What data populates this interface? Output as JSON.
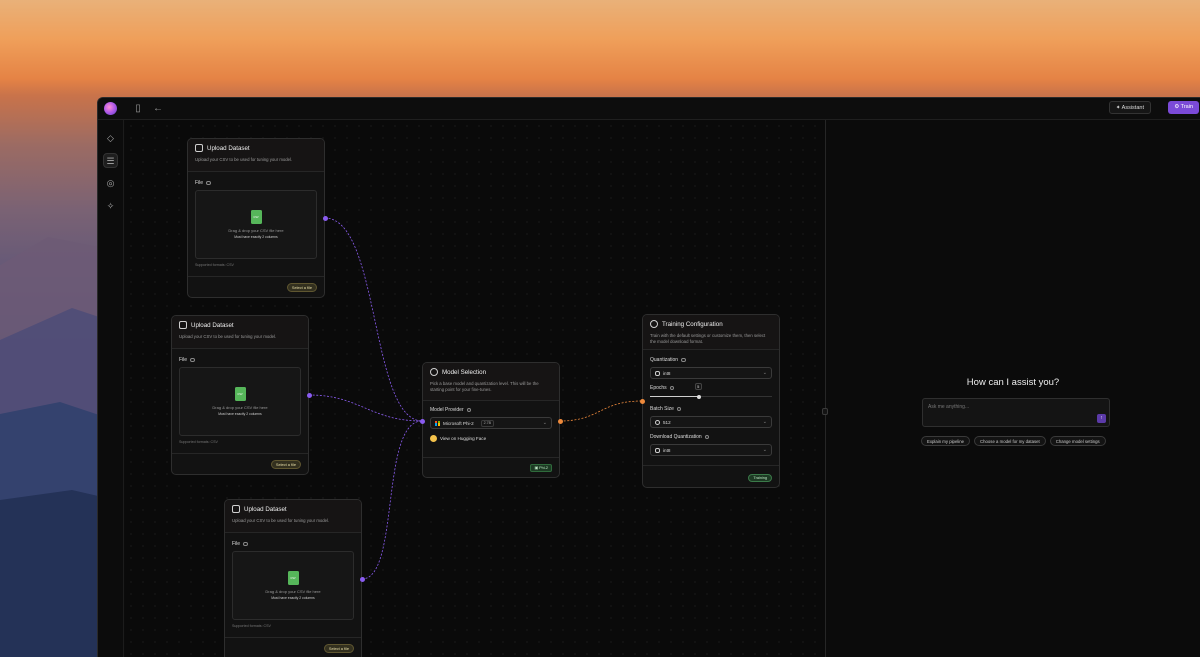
{
  "topbar": {
    "assistant_label": "Assistant",
    "train_label": "Train"
  },
  "upload_nodes": [
    {
      "title": "Upload Dataset",
      "subtitle": "Upload your CSV to be used for tuning your model.",
      "field_label": "File",
      "drop_text": "Drag & drop your CSV file here",
      "drop_hint": "Must have exactly 2 columns",
      "formats": "Supported formats: CSV",
      "button": "Select a file"
    },
    {
      "title": "Upload Dataset",
      "subtitle": "Upload your CSV to be used for tuning your model.",
      "field_label": "File",
      "drop_text": "Drag & drop your CSV file here",
      "drop_hint": "Must have exactly 2 columns",
      "formats": "Supported formats: CSV",
      "button": "Select a file"
    },
    {
      "title": "Upload Dataset",
      "subtitle": "Upload your CSV to be used for tuning your model.",
      "field_label": "File",
      "drop_text": "Drag & drop your CSV file here",
      "drop_hint": "Must have exactly 2 columns",
      "formats": "Supported formats: CSV",
      "button": "Select a file"
    }
  ],
  "model_node": {
    "title": "Model Selection",
    "subtitle": "Pick a base model and quantization level. This will be the starting point for your fine-tunes.",
    "field_label": "Model Provider",
    "selected_model": "Microsoft Phi-2",
    "selected_tag": "2.7B",
    "hf_link": "View on Hugging Face",
    "badge": "Phi-2"
  },
  "training_node": {
    "title": "Training Configuration",
    "subtitle": "Train with the default settings or customize them, then select the model download format.",
    "quantization_label": "Quantization",
    "quantization_value": "int8",
    "epochs_label": "Epochs",
    "epochs_value": "5",
    "epochs_fraction": 0.4,
    "batch_label": "Batch Size",
    "batch_value": "512",
    "download_label": "Download Quantization",
    "download_value": "int8",
    "badge": "Training"
  },
  "assistant": {
    "heading": "How can I assist you?",
    "placeholder": "Ask me anything...",
    "send_icon": "arrow-up-icon",
    "chips": [
      "Explain my pipeline",
      "Choose a model for my dataset",
      "Change model settings"
    ]
  },
  "colors": {
    "accent": "#7b4ad8",
    "port_purple": "#8a5cf0",
    "port_orange": "#ee8a3c",
    "csv_green": "#56b65a"
  }
}
